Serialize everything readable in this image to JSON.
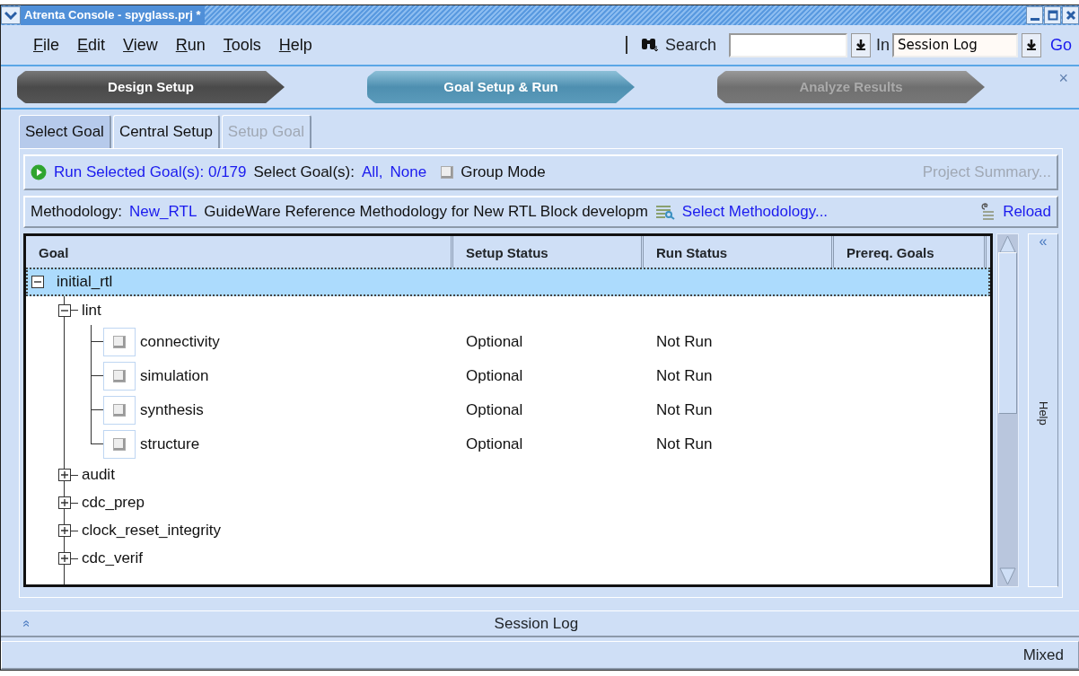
{
  "window": {
    "title": "Atrenta Console - spyglass.prj *"
  },
  "menu": [
    {
      "label": "File"
    },
    {
      "label": "Edit"
    },
    {
      "label": "View"
    },
    {
      "label": "Run"
    },
    {
      "label": "Tools"
    },
    {
      "label": "Help"
    }
  ],
  "search": {
    "label": "Search",
    "scope_label": "In",
    "scope_value": "Session Log",
    "go": "Go"
  },
  "steps": [
    {
      "label": "Design Setup",
      "selected": false,
      "disabled": false
    },
    {
      "label": "Goal Setup & Run",
      "selected": true,
      "disabled": false
    },
    {
      "label": "Analyze Results",
      "selected": false,
      "disabled": true
    }
  ],
  "close_glyph": "×",
  "tabs": [
    {
      "label": "Select Goal",
      "selected": true,
      "disabled": false
    },
    {
      "label": "Central Setup",
      "selected": false,
      "disabled": false
    },
    {
      "label": "Setup Goal",
      "selected": false,
      "disabled": true
    }
  ],
  "run_bar": {
    "run_link": "Run Selected Goal(s): 0/179",
    "select_label": "Select Goal(s):",
    "links": [
      "All,",
      "None"
    ],
    "group_mode": {
      "label": "Group Mode",
      "checked": false
    },
    "project_summary": {
      "label": "Project Summary...",
      "disabled": true
    }
  },
  "methodology": {
    "label": "Methodology:",
    "name": "New_RTL",
    "description": "GuideWare Reference Methodology for New RTL Block developm",
    "select": "Select Methodology...",
    "reload": "Reload"
  },
  "table": {
    "columns": [
      "Goal",
      "Setup Status",
      "Run Status",
      "Prereq. Goals"
    ],
    "tree": [
      {
        "label": "initial_rtl",
        "expanded": true,
        "selected": true,
        "children": [
          {
            "label": "lint",
            "expanded": true,
            "selected": false,
            "children": [
              {
                "label": "connectivity",
                "checked": false,
                "setup_status": "Optional",
                "run_status": "Not Run"
              },
              {
                "label": "simulation",
                "checked": false,
                "setup_status": "Optional",
                "run_status": "Not Run"
              },
              {
                "label": "synthesis",
                "checked": false,
                "setup_status": "Optional",
                "run_status": "Not Run"
              },
              {
                "label": "structure",
                "checked": false,
                "setup_status": "Optional",
                "run_status": "Not Run"
              }
            ]
          },
          {
            "label": "audit",
            "expanded": false,
            "selected": false
          },
          {
            "label": "cdc_prep",
            "expanded": false,
            "selected": false
          },
          {
            "label": "clock_reset_integrity",
            "expanded": false,
            "selected": false
          },
          {
            "label": "cdc_verif",
            "expanded": false,
            "selected": false
          }
        ]
      }
    ]
  },
  "help_panel": {
    "collapse_glyph": "«",
    "label": "Help"
  },
  "session_log": {
    "expand_glyph": "»",
    "label": "Session Log"
  },
  "status_bar": {
    "mode": "Mixed"
  }
}
